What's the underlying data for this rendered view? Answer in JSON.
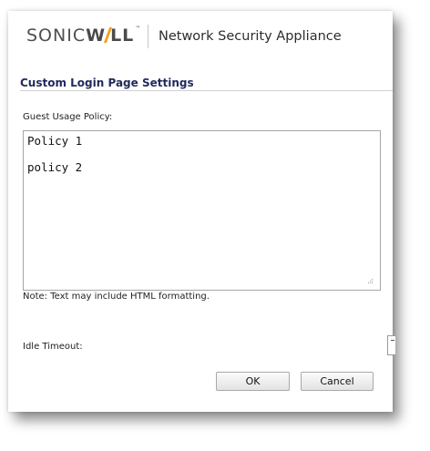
{
  "header": {
    "logo": {
      "part1": "SONIC",
      "part2_a": "W",
      "part2_b": "LL",
      "trademark": "™",
      "accent_color": "#f2a11c"
    },
    "product_name": "Network Security Appliance"
  },
  "section": {
    "title": "Custom Login Page Settings"
  },
  "guest_policy": {
    "label": "Guest Usage Policy:",
    "value": "Policy 1\n\npolicy 2",
    "note": "Note: Text may include HTML formatting."
  },
  "idle_timeout": {
    "label": "Idle Timeout:"
  },
  "buttons": {
    "ok": "OK",
    "cancel": "Cancel"
  },
  "colors": {
    "section_title": "#1f2a5c"
  }
}
